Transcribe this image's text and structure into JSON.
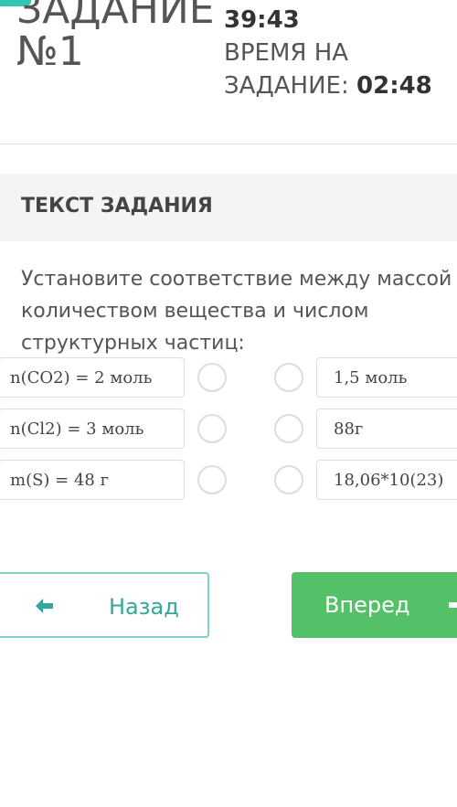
{
  "header": {
    "task_title_line1": "ЗАДАНИЕ",
    "task_title_line2": "№1",
    "timer_total": "39:43",
    "time_per_task_label_line1": "ВРЕМЯ НА",
    "time_per_task_label_line2": "ЗАДАНИЕ:",
    "time_per_task_value": "02:48"
  },
  "section": {
    "title": "ТЕКСТ ЗАДАНИЯ"
  },
  "question": {
    "line1": "Установите соответствие между массой",
    "line2": "количеством вещества и числом",
    "line3": "структурных частиц:"
  },
  "matching": {
    "left": [
      "n(CO2) = 2 моль",
      "n(Cl2) = 3 моль",
      "m(S) = 48 г"
    ],
    "right": [
      "1,5 моль",
      "88г",
      "18,06*10(23)"
    ]
  },
  "navigation": {
    "back_label": "Назад",
    "next_label": "Вперед"
  },
  "colors": {
    "accent_teal": "#34a898",
    "next_green": "#54c067"
  },
  "icons": {
    "back": "arrow-left-icon",
    "next": "arrow-right-icon"
  }
}
